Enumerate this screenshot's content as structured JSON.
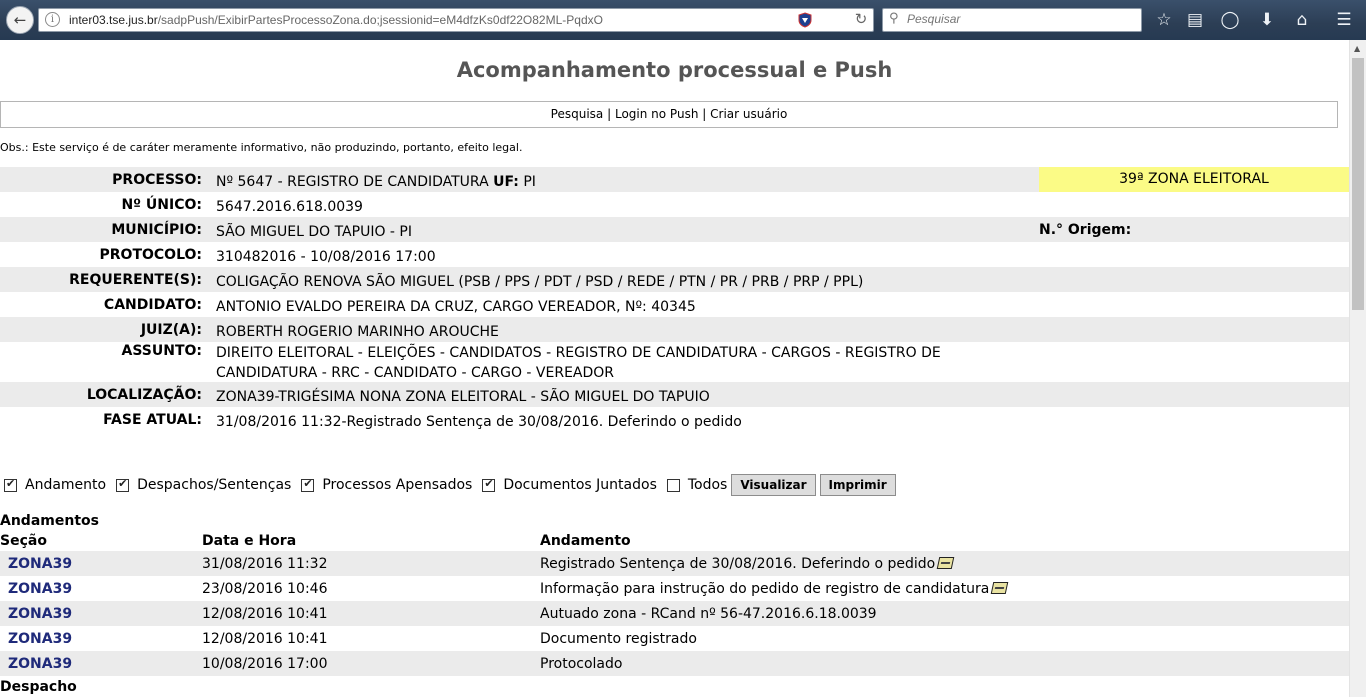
{
  "browser": {
    "url_host": "inter03.tse.jus.br",
    "url_path": "/sadpPush/ExibirPartesProcessoZona.do;jsessionid=eM4dfzKs0df22O82ML-PqdxO",
    "search_placeholder": "Pesquisar"
  },
  "page": {
    "title": "Acompanhamento processual e Push",
    "nav": {
      "pesquisa": "Pesquisa",
      "login": "Login no Push",
      "criar": "Criar usuário",
      "separator": "|"
    },
    "disclaimer": "Obs.: Este serviço é de caráter meramente informativo, não produzindo, portanto, efeito legal."
  },
  "info": {
    "processo_label": "PROCESSO:",
    "processo_value": "Nº 5647 - REGISTRO DE CANDIDATURA",
    "uf_label": "UF:",
    "uf_value": "PI",
    "zona": "39ª ZONA ELEITORAL",
    "numero_unico_label": "Nº ÚNICO:",
    "numero_unico_value": "5647.2016.618.0039",
    "municipio_label": "MUNICÍPIO:",
    "municipio_value": "SÃO MIGUEL DO TAPUIO - PI",
    "origem_label": "N.° Origem:",
    "protocolo_label": "PROTOCOLO:",
    "protocolo_value": "310482016 - 10/08/2016 17:00",
    "requerentes_label": "REQUERENTE(S):",
    "requerentes_value": "COLIGAÇÃO RENOVA SÃO MIGUEL (PSB / PPS / PDT / PSD / REDE / PTN / PR / PRB / PRP / PPL)",
    "candidato_label": "CANDIDATO:",
    "candidato_value": "ANTONIO EVALDO PEREIRA DA CRUZ, CARGO VEREADOR, Nº: 40345",
    "juiz_label": "JUIZ(A):",
    "juiz_value": "ROBERTH ROGERIO MARINHO AROUCHE",
    "assunto_label": "ASSUNTO:",
    "assunto_value": "DIREITO ELEITORAL - ELEIÇÕES - CANDIDATOS - REGISTRO DE CANDIDATURA - CARGOS - REGISTRO DE CANDIDATURA - RRC - CANDIDATO - CARGO - VEREADOR",
    "localizacao_label": "LOCALIZAÇÃO:",
    "localizacao_value": "ZONA39-TRIGÉSIMA NONA ZONA ELEITORAL - SÃO MIGUEL DO TAPUIO",
    "fase_label": "FASE ATUAL:",
    "fase_value": "31/08/2016 11:32-Registrado Sentença de 30/08/2016. Deferindo o pedido"
  },
  "filters": {
    "andamento": {
      "label": "Andamento",
      "checked": true
    },
    "despachos": {
      "label": "Despachos/Sentenças",
      "checked": true
    },
    "apensados": {
      "label": "Processos Apensados",
      "checked": true
    },
    "documentos": {
      "label": "Documentos Juntados",
      "checked": true
    },
    "todos": {
      "label": "Todos",
      "checked": false
    },
    "visualizar": "Visualizar",
    "imprimir": "Imprimir"
  },
  "andamentos": {
    "title": "Andamentos",
    "headers": {
      "secao": "Seção",
      "data": "Data e Hora",
      "andamento": "Andamento"
    },
    "rows": [
      {
        "secao": "ZONA39",
        "data": "31/08/2016 11:32",
        "andamento": "Registrado Sentença de 30/08/2016. Deferindo o pedido",
        "has_doc": true
      },
      {
        "secao": "ZONA39",
        "data": "23/08/2016 10:46",
        "andamento": "Informação para instrução do pedido de registro de candidatura",
        "has_doc": true
      },
      {
        "secao": "ZONA39",
        "data": "12/08/2016 10:41",
        "andamento": "Autuado zona - RCand nº 56-47.2016.6.18.0039",
        "has_doc": false
      },
      {
        "secao": "ZONA39",
        "data": "12/08/2016 10:41",
        "andamento": "Documento registrado",
        "has_doc": false
      },
      {
        "secao": "ZONA39",
        "data": "10/08/2016 17:00",
        "andamento": "Protocolado",
        "has_doc": false
      }
    ]
  },
  "despacho_title": "Despacho"
}
